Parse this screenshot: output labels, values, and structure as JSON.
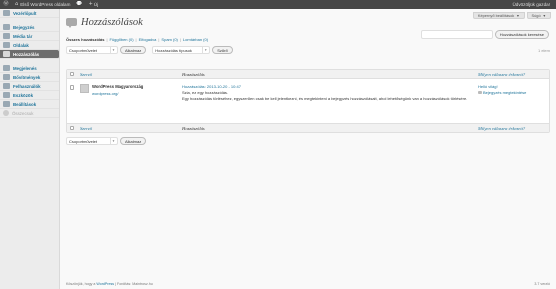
{
  "adminbar": {
    "site_name": "Első WordPress oldalam",
    "comments_icon": "speech-bubble-icon",
    "new_label": "Új",
    "greeting": "Üdvözöljük gazda!"
  },
  "sidebar": {
    "items": [
      {
        "label": "Vezérlőpult"
      },
      {
        "label": "Bejegyzés"
      },
      {
        "label": "Média tár"
      },
      {
        "label": "Oldalak"
      },
      {
        "label": "Hozzászólás"
      },
      {
        "label": "Megjelenés"
      },
      {
        "label": "Bővítmények"
      },
      {
        "label": "Felhasználók"
      },
      {
        "label": "Eszközök"
      },
      {
        "label": "Beállítások"
      },
      {
        "label": "Összecsuk"
      }
    ]
  },
  "screen_options": {
    "label": "Képernyő beállítások",
    "help": "Súgó"
  },
  "page": {
    "title": "Hozzászólások"
  },
  "filters": {
    "all": "Összes hozzászólás",
    "pending": "Függőben (0)",
    "approved": "Elfogadva",
    "spam": "Spam (0)",
    "trash": "Lomtárban (0)",
    "sep": "|"
  },
  "search": {
    "button": "Hozzászólások keresése"
  },
  "tablenav": {
    "bulk_select": "Csoportművelet",
    "apply": "Alkalmaz",
    "type_select": "Hozzászólás típusok",
    "filter": "Szűrő",
    "items": "1 elem"
  },
  "table": {
    "headers": {
      "author": "Szerző",
      "comment": "Hozzászólás",
      "response": "Milyen válaszra érkezett?"
    },
    "rows": [
      {
        "author": "WordPress Magyarország",
        "author_url": "wordpress.org/",
        "submitted": "Hozzászólás: 2013-10-20 - 10:47",
        "greeting": "Szia, ez egy hozzászólás.",
        "body": "Egy hozzászólás törléséhez, egyszerűen csak be kell jelentkezni, és megtekinteni a bejegyzés hozzászólásait, ahol lehetőségünk van a hozzászólások törlésére.",
        "response_title": "Helló világ!",
        "response_view": "Bejegyzés megtekintése"
      }
    ]
  },
  "footer": {
    "thanks_prefix": "Köszönjük, hogy a ",
    "wordpress": "WordPress",
    "thanks_suffix": " | Fordítás: Maintrosz.hu",
    "version": "3.7 verzió"
  }
}
